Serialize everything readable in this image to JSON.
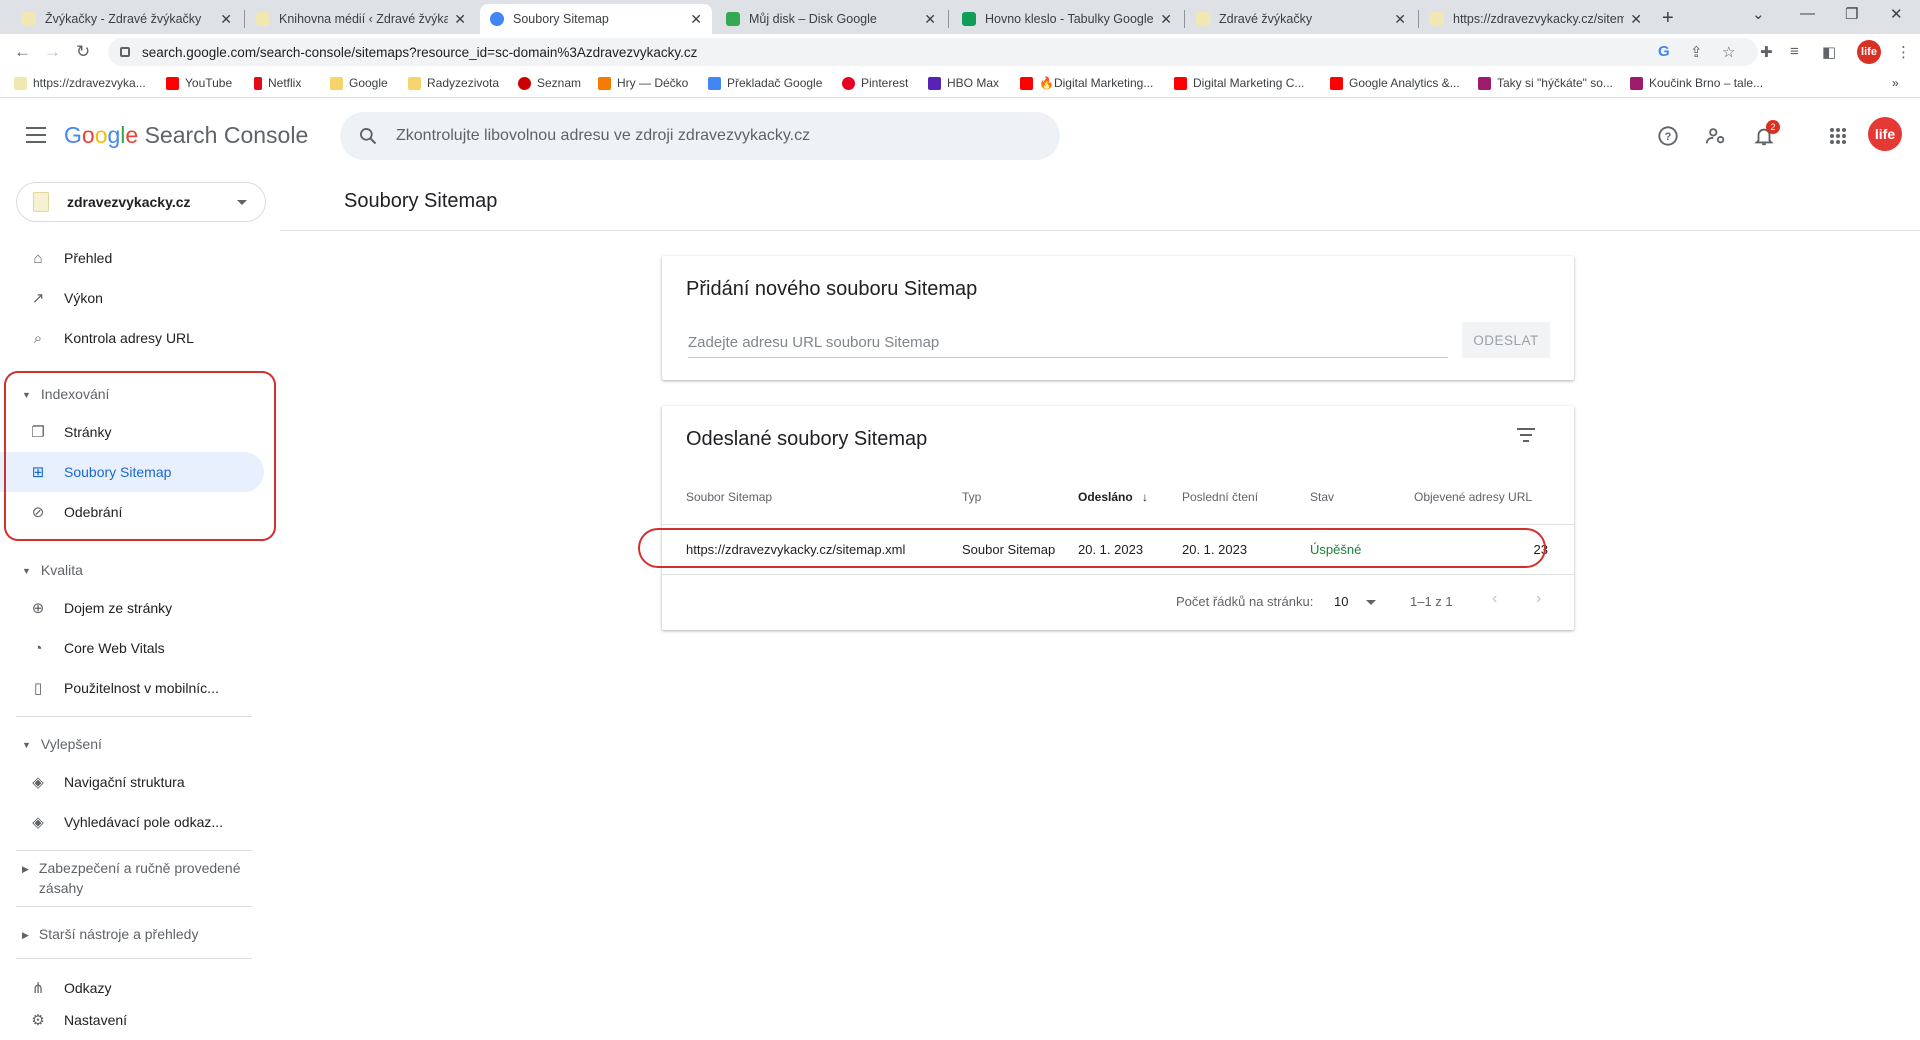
{
  "browser": {
    "tabs": [
      {
        "title": "Žvýkačky - Zdravé žvýkačky",
        "favicon_color": "#f1e7b0"
      },
      {
        "title": "Knihovna médií ‹ Zdravé žvýkač",
        "favicon_color": "#f1e7b0"
      },
      {
        "title": "Soubory Sitemap",
        "favicon_color": "#4285f4"
      },
      {
        "title": "Můj disk – Disk Google",
        "favicon_color": "#34a853"
      },
      {
        "title": "Hovno kleslo - Tabulky Google",
        "favicon_color": "#0f9d58"
      },
      {
        "title": "Zdravé žvýkačky",
        "favicon_color": "#f1e7b0"
      },
      {
        "title": "https://zdravezvykacky.cz/sitem",
        "favicon_color": "#f1e7b0"
      }
    ],
    "new_tab": "+",
    "url": "search.google.com/search-console/sitemaps?resource_id=sc-domain%3Azdravezvykacky.cz",
    "bookmarks": [
      {
        "label": "https://zdravezvyka...",
        "color": "#f1e7b0"
      },
      {
        "label": "YouTube",
        "color": "#ff0000"
      },
      {
        "label": "Netflix",
        "color": "#e50914"
      },
      {
        "label": "Google",
        "color": "#f6d36b"
      },
      {
        "label": "Radyzezivota",
        "color": "#f6d36b"
      },
      {
        "label": "Seznam",
        "color": "#cc0000"
      },
      {
        "label": "Hry — Déčko",
        "color": "#f57c00"
      },
      {
        "label": "Překladač Google",
        "color": "#4285f4"
      },
      {
        "label": "Pinterest",
        "color": "#e60023"
      },
      {
        "label": "HBO Max",
        "color": "#5822b4"
      },
      {
        "label": "🔥Digital Marketing...",
        "color": "#ff0000"
      },
      {
        "label": "Digital Marketing C...",
        "color": "#ff0000"
      },
      {
        "label": "Google Analytics &...",
        "color": "#ff0000"
      },
      {
        "label": "Taky si \"hýčkáte\" so...",
        "color": "#9c1c6b"
      },
      {
        "label": "Koučink Brno – tale...",
        "color": "#9c1c6b"
      }
    ],
    "more": "»"
  },
  "header": {
    "logo_google": [
      "G",
      "o",
      "o",
      "g",
      "l",
      "e"
    ],
    "logo_rest": "Search Console",
    "search_placeholder": "Zkontrolujte libovolnou adresu ve zdroji zdravezvykacky.cz",
    "notification_count": "2",
    "user_initials": "life"
  },
  "sidebar": {
    "property": "zdravezvykacky.cz",
    "items_top": [
      {
        "label": "Přehled",
        "icon": "home-icon"
      },
      {
        "label": "Výkon",
        "icon": "trending-icon"
      },
      {
        "label": "Kontrola adresy URL",
        "icon": "search-icon"
      }
    ],
    "section_indexing": "Indexování",
    "items_indexing": [
      {
        "label": "Stránky",
        "icon": "pages-icon"
      },
      {
        "label": "Soubory Sitemap",
        "icon": "sitemap-icon"
      },
      {
        "label": "Odebrání",
        "icon": "eye-off-icon"
      }
    ],
    "section_quality": "Kvalita",
    "items_quality": [
      {
        "label": "Dojem ze stránky",
        "icon": "plus-circle-icon"
      },
      {
        "label": "Core Web Vitals",
        "icon": "gauge-icon"
      },
      {
        "label": "Použitelnost v mobilníc...",
        "icon": "phone-icon"
      }
    ],
    "section_enhancements": "Vylepšení",
    "items_enhancements": [
      {
        "label": "Navigační struktura",
        "icon": "layers-icon"
      },
      {
        "label": "Vyhledávací pole odkaz...",
        "icon": "layers-icon"
      }
    ],
    "section_security": "Zabezpečení a ručně provedené zásahy",
    "section_legacy": "Starší nástroje a přehledy",
    "items_bottom": [
      {
        "label": "Odkazy",
        "icon": "links-icon"
      },
      {
        "label": "Nastavení",
        "icon": "settings-icon"
      }
    ]
  },
  "main": {
    "page_title": "Soubory Sitemap",
    "add_card": {
      "title": "Přidání nového souboru Sitemap",
      "placeholder": "Zadejte adresu URL souboru Sitemap",
      "submit": "ODESLAT"
    },
    "submitted_card": {
      "title": "Odeslané soubory Sitemap",
      "columns": [
        "Soubor Sitemap",
        "Typ",
        "Odesláno",
        "Poslední čtení",
        "Stav",
        "Objevené adresy URL"
      ],
      "sort_arrow": "↓",
      "rows": [
        {
          "file": "https://zdravezvykacky.cz/sitemap.xml",
          "type": "Soubor Sitemap",
          "submitted": "20. 1. 2023",
          "last_read": "20. 1. 2023",
          "status": "Úspěšné",
          "urls": "23"
        }
      ],
      "rows_per_page_label": "Počet řádků na stránku:",
      "rows_per_page": "10",
      "range": "1–1 z 1"
    }
  }
}
